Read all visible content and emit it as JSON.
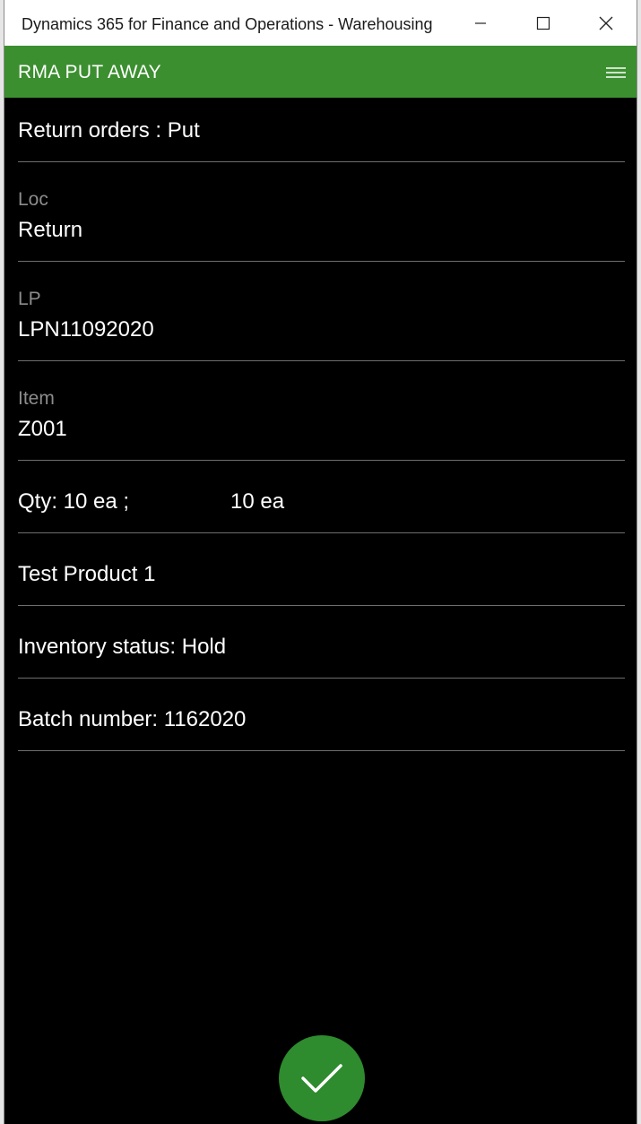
{
  "window": {
    "title": "Dynamics 365 for Finance and Operations - Warehousing"
  },
  "appbar": {
    "title": "RMA PUT AWAY",
    "color": "#3b8f2f"
  },
  "fields": {
    "header": "Return orders : Put",
    "loc": {
      "label": "Loc",
      "value": "Return"
    },
    "lp": {
      "label": "LP",
      "value": "LPN11092020"
    },
    "item": {
      "label": "Item",
      "value": "Z001"
    },
    "qty": {
      "text": "Qty: 10 ea ;",
      "second": "10 ea"
    },
    "product": "Test Product 1",
    "inventory_status": "Inventory status: Hold",
    "batch": "Batch number: 1162020"
  },
  "icons": {
    "menu": "hamburger-icon",
    "confirm": "checkmark-icon",
    "minimize": "minimize-icon",
    "maximize": "maximize-icon",
    "close": "close-icon"
  },
  "colors": {
    "confirm_button": "#2e8b2e",
    "background": "#000000"
  }
}
